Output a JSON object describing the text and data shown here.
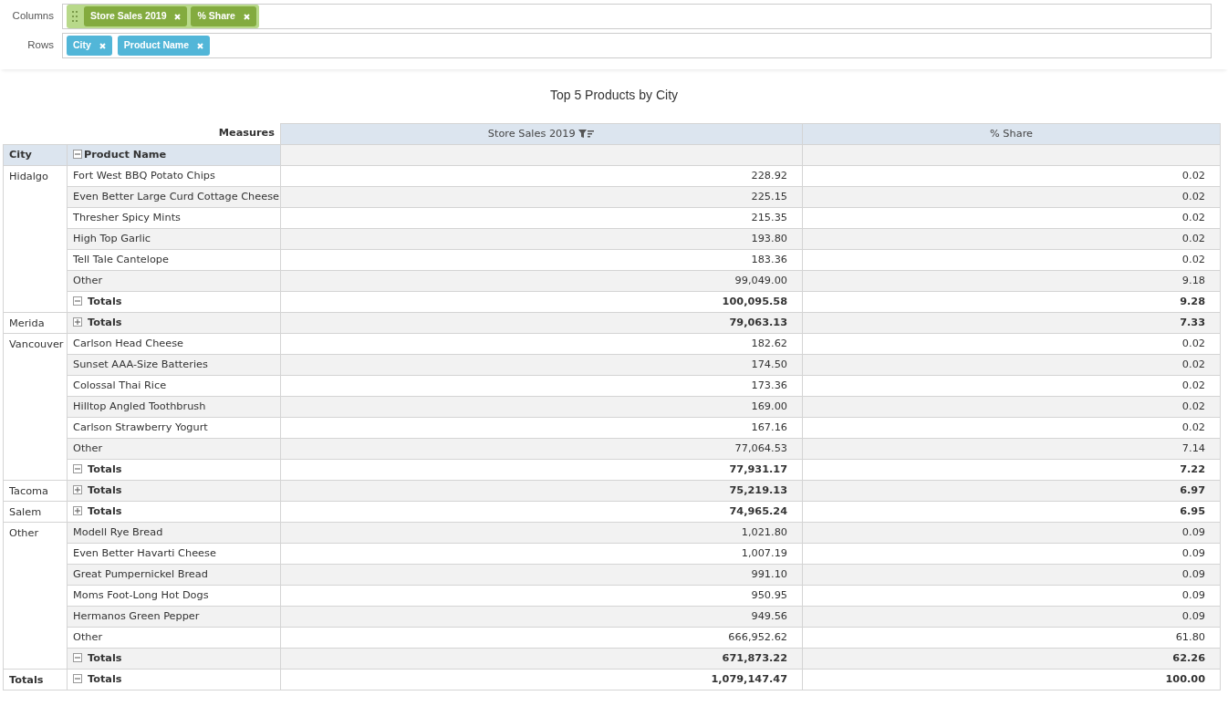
{
  "fields": {
    "columns": {
      "label": "Columns",
      "chips": [
        {
          "label": "Store Sales 2019"
        },
        {
          "label": "% Share"
        }
      ]
    },
    "rows": {
      "label": "Rows",
      "chips": [
        {
          "label": "City"
        },
        {
          "label": "Product Name"
        }
      ]
    }
  },
  "title": "Top 5 Products by City",
  "table": {
    "measures_label": "Measures",
    "columns": [
      {
        "label": "Store Sales 2019",
        "filtered": true
      },
      {
        "label": "% Share",
        "filtered": false
      }
    ],
    "row_headers": [
      {
        "label": "City"
      },
      {
        "label": "Product Name",
        "expanded": true
      }
    ],
    "groups": [
      {
        "city": "Hidalgo",
        "expanded": true,
        "rows": [
          {
            "product": "Fort West BBQ Potato Chips",
            "sales": "228.92",
            "share": "0.02"
          },
          {
            "product": "Even Better Large Curd Cottage Cheese",
            "sales": "225.15",
            "share": "0.02"
          },
          {
            "product": "Thresher Spicy Mints",
            "sales": "215.35",
            "share": "0.02"
          },
          {
            "product": "High Top Garlic",
            "sales": "193.80",
            "share": "0.02"
          },
          {
            "product": "Tell Tale Cantelope",
            "sales": "183.36",
            "share": "0.02"
          },
          {
            "product": "Other",
            "sales": "99,049.00",
            "share": "9.18"
          }
        ],
        "totals": {
          "label": "Totals",
          "sales": "100,095.58",
          "share": "9.28"
        }
      },
      {
        "city": "Merida",
        "expanded": false,
        "totals": {
          "label": "Totals",
          "sales": "79,063.13",
          "share": "7.33"
        }
      },
      {
        "city": "Vancouver",
        "expanded": true,
        "rows": [
          {
            "product": "Carlson Head Cheese",
            "sales": "182.62",
            "share": "0.02"
          },
          {
            "product": "Sunset AAA-Size Batteries",
            "sales": "174.50",
            "share": "0.02"
          },
          {
            "product": "Colossal Thai Rice",
            "sales": "173.36",
            "share": "0.02"
          },
          {
            "product": "Hilltop Angled Toothbrush",
            "sales": "169.00",
            "share": "0.02"
          },
          {
            "product": "Carlson Strawberry Yogurt",
            "sales": "167.16",
            "share": "0.02"
          },
          {
            "product": "Other",
            "sales": "77,064.53",
            "share": "7.14"
          }
        ],
        "totals": {
          "label": "Totals",
          "sales": "77,931.17",
          "share": "7.22"
        }
      },
      {
        "city": "Tacoma",
        "expanded": false,
        "totals": {
          "label": "Totals",
          "sales": "75,219.13",
          "share": "6.97"
        }
      },
      {
        "city": "Salem",
        "expanded": false,
        "totals": {
          "label": "Totals",
          "sales": "74,965.24",
          "share": "6.95"
        }
      },
      {
        "city": "Other",
        "expanded": true,
        "rows": [
          {
            "product": "Modell Rye Bread",
            "sales": "1,021.80",
            "share": "0.09"
          },
          {
            "product": "Even Better Havarti Cheese",
            "sales": "1,007.19",
            "share": "0.09"
          },
          {
            "product": "Great Pumpernickel Bread",
            "sales": "991.10",
            "share": "0.09"
          },
          {
            "product": "Moms Foot-Long Hot Dogs",
            "sales": "950.95",
            "share": "0.09"
          },
          {
            "product": "Hermanos Green Pepper",
            "sales": "949.56",
            "share": "0.09"
          },
          {
            "product": "Other",
            "sales": "666,952.62",
            "share": "61.80"
          }
        ],
        "totals": {
          "label": "Totals",
          "sales": "671,873.22",
          "share": "62.26"
        }
      }
    ],
    "grand_total": {
      "city": "Totals",
      "label": "Totals",
      "expanded": true,
      "sales": "1,079,147.47",
      "share": "100.00"
    }
  }
}
